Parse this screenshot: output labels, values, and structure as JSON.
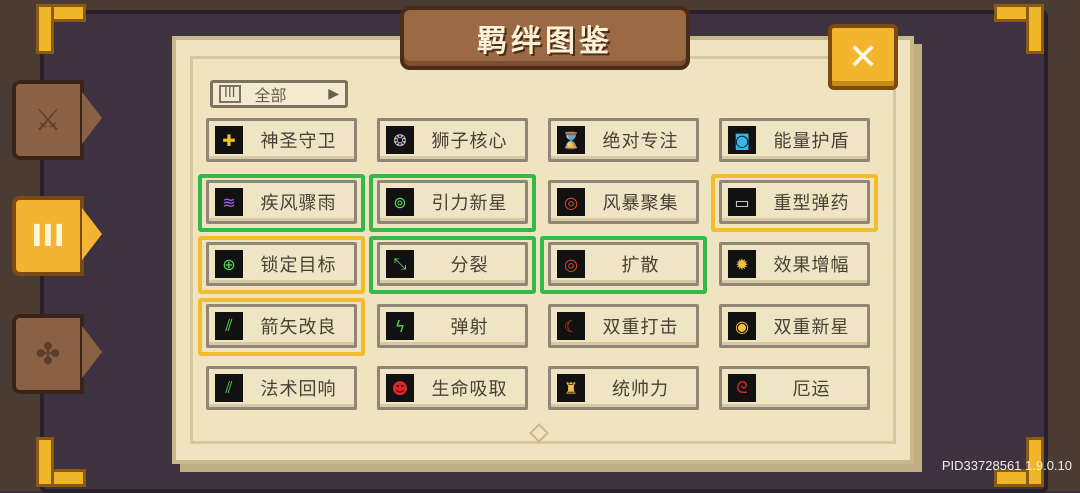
{
  "title": "羁绊图鉴",
  "close_label": "✕",
  "filter": {
    "label": "全部",
    "icon": "bars-icon",
    "arrow": "▶"
  },
  "side_tabs": [
    {
      "icon": "sword-icon",
      "glyph": "⚔"
    },
    {
      "icon": "bars-icon",
      "glyph": "III"
    },
    {
      "icon": "clover-icon",
      "glyph": "✤"
    }
  ],
  "synergies": [
    {
      "label": "神圣守卫",
      "highlight": "none",
      "icon": "shield-cross-icon",
      "icon_glyph": "✚",
      "icon_color": "#f3c42b"
    },
    {
      "label": "狮子核心",
      "highlight": "none",
      "icon": "lion-icon",
      "icon_glyph": "❂",
      "icon_color": "#b8b8b8"
    },
    {
      "label": "绝对专注",
      "highlight": "none",
      "icon": "hourglass-icon",
      "icon_glyph": "⌛",
      "icon_color": "#e89a3a"
    },
    {
      "label": "能量护盾",
      "highlight": "none",
      "icon": "energy-shield-icon",
      "icon_glyph": "◙",
      "icon_color": "#3ab6e8"
    },
    {
      "label": "疾风骤雨",
      "highlight": "green",
      "icon": "tornado-icon",
      "icon_glyph": "≋",
      "icon_color": "#a860e0"
    },
    {
      "label": "引力新星",
      "highlight": "green",
      "icon": "gravity-nova-icon",
      "icon_glyph": "⊚",
      "icon_color": "#4fd85a"
    },
    {
      "label": "风暴聚集",
      "highlight": "none",
      "icon": "storm-target-icon",
      "icon_glyph": "◎",
      "icon_color": "#e8503a"
    },
    {
      "label": "重型弹药",
      "highlight": "gold",
      "icon": "heavy-ammo-icon",
      "icon_glyph": "▭",
      "icon_color": "#e0e0e0"
    },
    {
      "label": "锁定目标",
      "highlight": "gold",
      "icon": "crosshair-icon",
      "icon_glyph": "⊕",
      "icon_color": "#4fd85a"
    },
    {
      "label": "分裂",
      "highlight": "green",
      "icon": "split-arrows-icon",
      "icon_glyph": "⤡",
      "icon_color": "#6ee060"
    },
    {
      "label": "扩散",
      "highlight": "green",
      "icon": "spread-rings-icon",
      "icon_glyph": "◎",
      "icon_color": "#e0502a"
    },
    {
      "label": "效果增幅",
      "highlight": "none",
      "icon": "amplify-icon",
      "icon_glyph": "✹",
      "icon_color": "#f0c040"
    },
    {
      "label": "箭矢改良",
      "highlight": "gold",
      "icon": "arrows-icon",
      "icon_glyph": "⫽",
      "icon_color": "#6ee060"
    },
    {
      "label": "弹射",
      "highlight": "none",
      "icon": "bounce-icon",
      "icon_glyph": "ϟ",
      "icon_color": "#4fd85a"
    },
    {
      "label": "双重打击",
      "highlight": "none",
      "icon": "double-strike-icon",
      "icon_glyph": "☾",
      "icon_color": "#e0402a"
    },
    {
      "label": "双重新星",
      "highlight": "none",
      "icon": "double-nova-icon",
      "icon_glyph": "◉",
      "icon_color": "#f0c040"
    },
    {
      "label": "法术回响",
      "highlight": "none",
      "icon": "spell-echo-icon",
      "icon_glyph": "⫽",
      "icon_color": "#4fd85a"
    },
    {
      "label": "生命吸取",
      "highlight": "none",
      "icon": "life-drain-icon",
      "icon_glyph": "☻",
      "icon_color": "#d8282a"
    },
    {
      "label": "统帅力",
      "highlight": "none",
      "icon": "commander-icon",
      "icon_glyph": "♜",
      "icon_color": "#f0c040"
    },
    {
      "label": "厄运",
      "highlight": "none",
      "icon": "doom-swirl-icon",
      "icon_glyph": "ᘓ",
      "icon_color": "#d8282a"
    }
  ],
  "version": "PID33728561 1.9.0.10"
}
